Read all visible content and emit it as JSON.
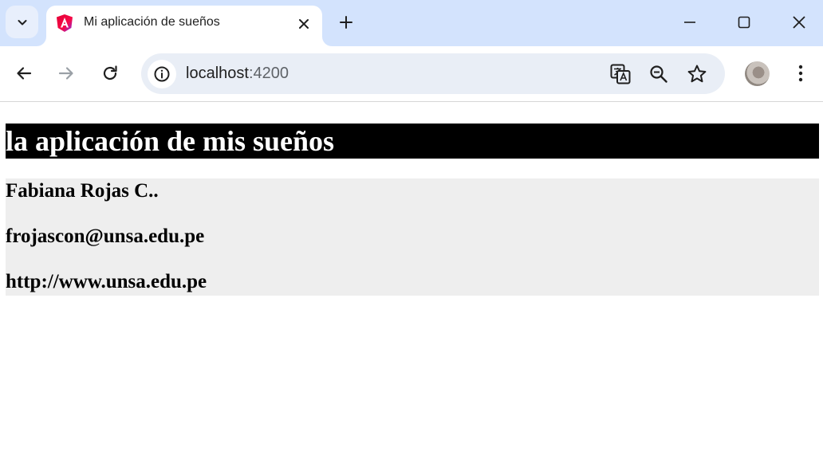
{
  "browser": {
    "tab": {
      "title": "Mi aplicación de sueños",
      "favicon": "angular-icon"
    },
    "url": {
      "host": "localhost",
      "port": ":4200"
    },
    "icons": {
      "tab_search": "chevron-down-icon",
      "close_tab": "close-icon",
      "new_tab": "plus-icon",
      "minimize": "minimize-icon",
      "maximize": "maximize-icon",
      "close_window": "close-icon",
      "back": "arrow-left-icon",
      "forward": "arrow-right-icon",
      "reload": "reload-icon",
      "site_info": "info-icon",
      "translate": "translate-icon",
      "zoom": "zoom-out-icon",
      "bookmark": "star-icon",
      "profile": "avatar",
      "menu": "more-vertical-icon"
    },
    "colors": {
      "tabstrip": "#d3e3fd",
      "omnibox": "#e9eef6"
    }
  },
  "page": {
    "heading": "la aplicación de mis sueños",
    "name": "Fabiana Rojas C..",
    "email": "frojascon@unsa.edu.pe",
    "website": "http://www.unsa.edu.pe",
    "colors": {
      "heading_bg": "#000000",
      "heading_text": "#ffffff",
      "info_bg": "#eeeeee"
    }
  }
}
